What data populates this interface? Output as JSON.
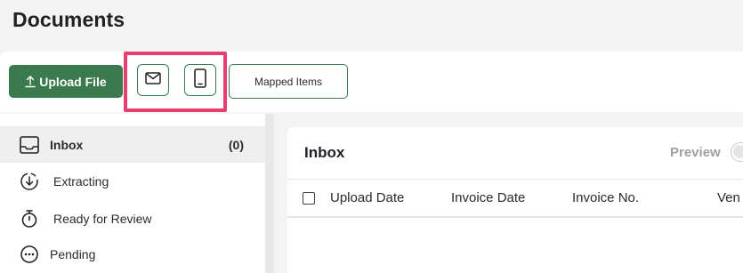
{
  "page": {
    "title": "Documents"
  },
  "toolbar": {
    "upload_label": "Upload File",
    "email_icon": "mail-icon",
    "mobile_icon": "smartphone-icon",
    "mapped_items_label": "Mapped Items",
    "accent": "#3a7a4d",
    "highlight_color": "#e83f73"
  },
  "sidebar": {
    "items": [
      {
        "label": "Inbox",
        "count": "(0)",
        "icon": "inbox-icon"
      },
      {
        "label": "Extracting",
        "icon": "download-circle-icon"
      },
      {
        "label": "Ready for Review",
        "icon": "stopwatch-icon"
      },
      {
        "label": "Pending",
        "icon": "more-circle-icon"
      }
    ]
  },
  "panel": {
    "title": "Inbox",
    "preview_label": "Preview",
    "columns": [
      "Upload Date",
      "Invoice Date",
      "Invoice No.",
      "Ven"
    ]
  }
}
